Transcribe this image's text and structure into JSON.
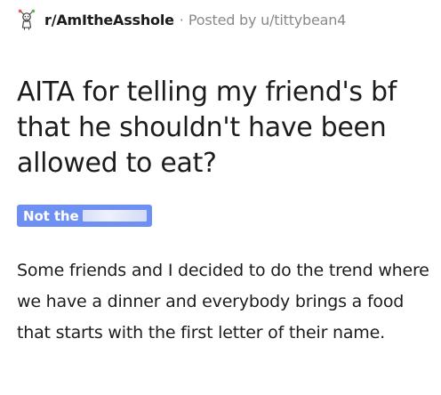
{
  "post": {
    "subreddit": "r/AmItheAsshole",
    "separator": "·",
    "posted_by": "Posted by u/tittybean4",
    "subreddit_icon": "aita-mascot-icon",
    "title": "AITA for telling my friend's bf that he shouldn't have been allowed to eat?",
    "flair": {
      "label": "Not the",
      "redacted": true,
      "color": "#6e90f2"
    },
    "body": "Some friends and I decided to do the trend where we have a dinner and everybody brings a food that starts with the first letter of their name."
  },
  "colors": {
    "text_primary": "#1c1c1c",
    "text_secondary": "#878a8c",
    "flair_bg": "#6e90f2",
    "background": "#ffffff"
  }
}
